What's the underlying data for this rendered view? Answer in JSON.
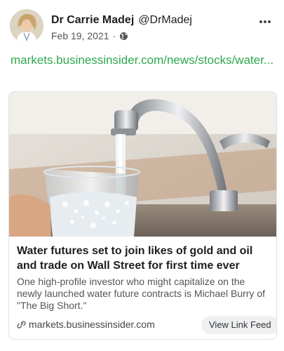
{
  "post": {
    "author_name": "Dr Carrie Madej",
    "author_handle": "@DrMadej",
    "date": "Feb 19, 2021",
    "separator": "·",
    "visibility_icon": "globe-icon",
    "more_icon": "more-options-icon",
    "link_text": "markets.businessinsider.com/news/stocks/water..."
  },
  "card": {
    "image_subject": "water-glass-faucet-image",
    "title": "Water futures set to join likes of gold and oil and trade on Wall Street for first time ever",
    "description": "One high-profile investor who might capitalize on the newly launched water future contracts is Michael Burry of \"The Big Short.\"",
    "domain": "markets.businessinsider.com",
    "button_label": "View Link Feed",
    "link_icon": "link-icon"
  },
  "colors": {
    "link_green": "#2fa84f",
    "card_border": "#dfe1e4",
    "button_bg": "#eef0f2"
  }
}
